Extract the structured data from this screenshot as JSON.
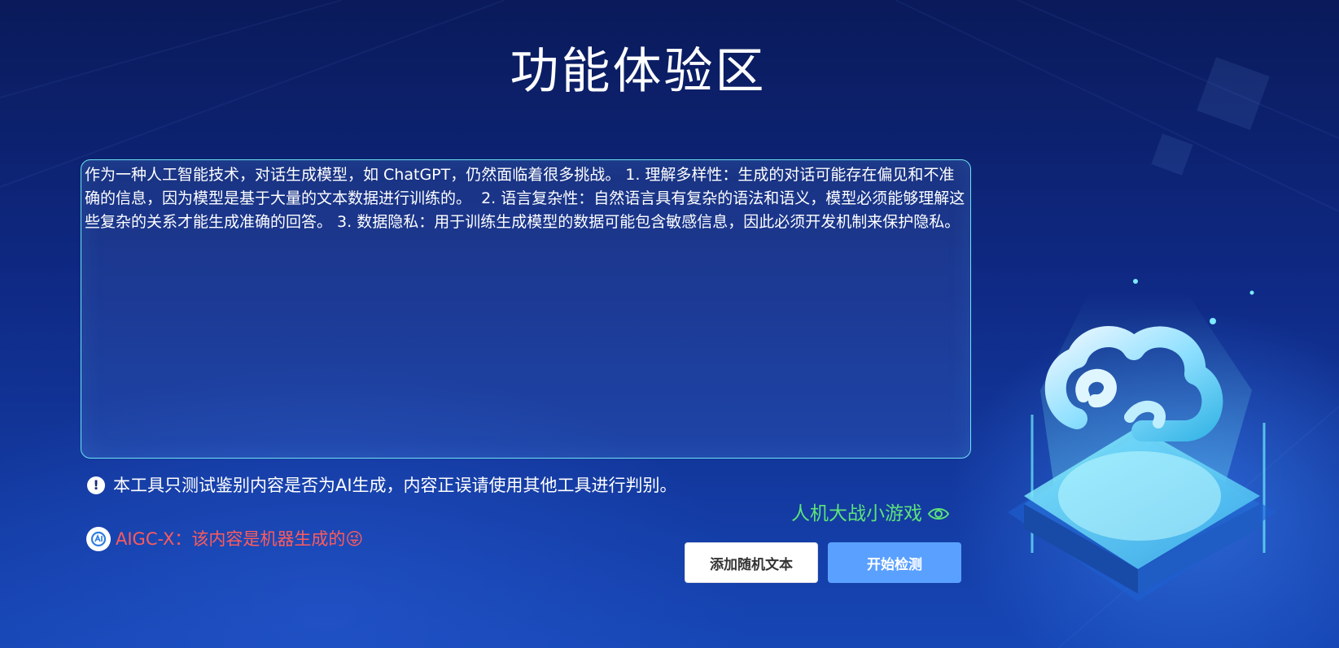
{
  "page": {
    "title": "功能体验区"
  },
  "input": {
    "text": "作为一种人工智能技术，对话生成模型，如 ChatGPT，仍然面临着很多挑战。 1. 理解多样性：生成的对话可能存在偏见和不准确的信息，因为模型是基于大量的文本数据进行训练的。  2. 语言复杂性：自然语言具有复杂的语法和语义，模型必须能够理解这些复杂的关系才能生成准确的回答。 3. 数据隐私：用于训练生成模型的数据可能包含敏感信息，因此必须开发机制来保护隐私。"
  },
  "notice": {
    "icon": "exclamation-circle-icon",
    "text": "本工具只测试鉴别内容是否为AI生成，内容正误请使用其他工具进行判别。"
  },
  "game_link": {
    "label": "人机大战小游戏",
    "icon": "eye-icon"
  },
  "result": {
    "logo": "aigc-x-logo",
    "text": "AIGC-X：该内容是机器生成的😜"
  },
  "buttons": {
    "random_label": "添加随机文本",
    "detect_label": "开始检测"
  },
  "colors": {
    "background_top": "#0a1a5a",
    "background_bottom": "#1646b5",
    "textbox_border": "#6fe3f2",
    "game_link": "#5de37a",
    "result_text": "#ff5b5b",
    "detect_button": "#5aa0ff"
  }
}
